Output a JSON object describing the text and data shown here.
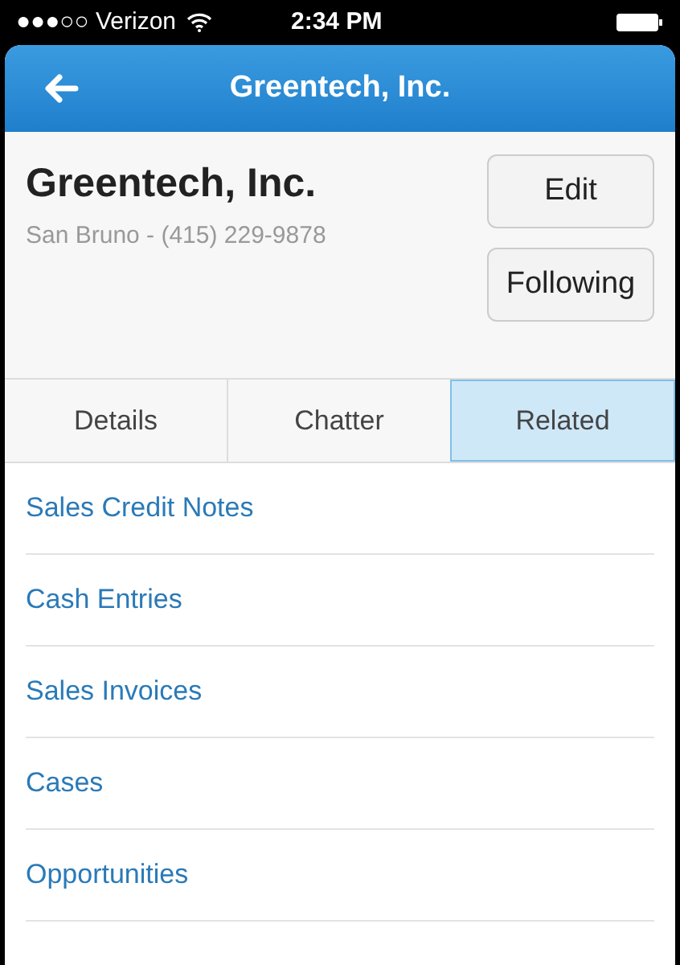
{
  "status_bar": {
    "carrier": "●●●○○ Verizon",
    "time": "2:34 PM"
  },
  "nav_bar": {
    "title": "Greentech, Inc."
  },
  "record": {
    "name": "Greentech, Inc.",
    "subtitle": "San Bruno - (415) 229-9878",
    "buttons": [
      "Edit",
      "Following"
    ]
  },
  "tabs": [
    {
      "label": "Details",
      "selected": false
    },
    {
      "label": "Chatter",
      "selected": false
    },
    {
      "label": "Related",
      "selected": true
    }
  ],
  "related_list": [
    "Sales Credit Notes",
    "Cash Entries",
    "Sales Invoices",
    "Cases",
    "Opportunities"
  ]
}
